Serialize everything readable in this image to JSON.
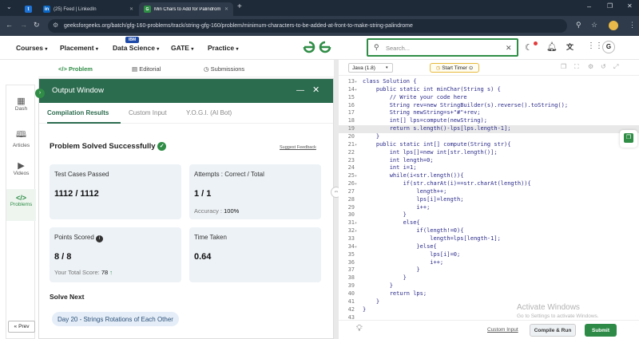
{
  "browser": {
    "tabs": [
      {
        "label": "(25) Feed | LinkedIn"
      },
      {
        "label": "Min Chars to Add for Palindrom"
      }
    ],
    "url": "geeksforgeeks.org/batch/gfg-160-problems/track/string-gfg-160/problem/minimum-characters-to-be-added-at-front-to-make-string-palindrome"
  },
  "site": {
    "nav": [
      "Courses",
      "Placement",
      "Data Science",
      "GATE",
      "Practice"
    ],
    "badge": "IBM",
    "search_placeholder": "Search...",
    "avatar": "G"
  },
  "rail": [
    {
      "label": "Dash"
    },
    {
      "label": "Articles"
    },
    {
      "label": "Videos"
    },
    {
      "label": "Problems"
    }
  ],
  "prev_label": "Prev",
  "problem_tabs": [
    "Problem",
    "Editorial",
    "Submissions"
  ],
  "output": {
    "title": "Output Window",
    "tabs": [
      "Compilation Results",
      "Custom Input",
      "Y.O.G.I. (AI Bot)"
    ],
    "status": "Problem Solved Successfully",
    "suggest": "Suggest Feedback",
    "cards": {
      "tests_label": "Test Cases Passed",
      "tests_value": "1112 / 1112",
      "attempts_label": "Attempts : Correct / Total",
      "attempts_value": "1 / 1",
      "accuracy_label": "Accuracy :",
      "accuracy_value": "100%",
      "points_label": "Points Scored",
      "points_value": "8 / 8",
      "total_label": "Your Total Score:",
      "total_value": "78",
      "time_label": "Time Taken",
      "time_value": "0.64"
    },
    "solve_next": "Solve Next",
    "next_problem": "Day 20 - Strings Rotations of Each Other"
  },
  "editor": {
    "language": "Java (1.8)",
    "timer": "Start Timer",
    "lines": [
      {
        "n": "13",
        "f": "▾",
        "t": "class Solution {"
      },
      {
        "n": "14",
        "f": "▾",
        "t": "    public static int minChar(String s) {"
      },
      {
        "n": "15",
        "f": "",
        "t": "        // Write your code here"
      },
      {
        "n": "16",
        "f": "",
        "t": "        String rev=new StringBuilder(s).reverse().toString();"
      },
      {
        "n": "17",
        "f": "",
        "t": "        String newString=s+\"#\"+rev;"
      },
      {
        "n": "18",
        "f": "",
        "t": "        int[] lps=compute(newString);"
      },
      {
        "n": "19",
        "f": "",
        "t": "        return s.length()-lps[lps.length-1];"
      },
      {
        "n": "20",
        "f": "",
        "t": "    }"
      },
      {
        "n": "21",
        "f": "▾",
        "t": "    public static int[] compute(String str){"
      },
      {
        "n": "22",
        "f": "",
        "t": "        int lps[]=new int[str.length()];"
      },
      {
        "n": "23",
        "f": "",
        "t": "        int length=0;"
      },
      {
        "n": "24",
        "f": "",
        "t": "        int i=1;"
      },
      {
        "n": "25",
        "f": "▾",
        "t": "        while(i<str.length()){"
      },
      {
        "n": "26",
        "f": "▾",
        "t": "            if(str.charAt(i)==str.charAt(length)){"
      },
      {
        "n": "27",
        "f": "",
        "t": "                length++;"
      },
      {
        "n": "28",
        "f": "",
        "t": "                lps[i]=length;"
      },
      {
        "n": "29",
        "f": "",
        "t": "                i++;"
      },
      {
        "n": "30",
        "f": "",
        "t": "            }"
      },
      {
        "n": "31",
        "f": "▾",
        "t": "            else{"
      },
      {
        "n": "32",
        "f": "▾",
        "t": "                if(length!=0){"
      },
      {
        "n": "33",
        "f": "",
        "t": "                    length=lps[length-1];"
      },
      {
        "n": "34",
        "f": "▾",
        "t": "                }else{"
      },
      {
        "n": "35",
        "f": "",
        "t": "                    lps[i]=0;"
      },
      {
        "n": "36",
        "f": "",
        "t": "                    i++;"
      },
      {
        "n": "37",
        "f": "",
        "t": "                }"
      },
      {
        "n": "38",
        "f": "",
        "t": "            }"
      },
      {
        "n": "39",
        "f": "",
        "t": "        }"
      },
      {
        "n": "40",
        "f": "",
        "t": "        return lps;"
      },
      {
        "n": "41",
        "f": "",
        "t": "    }"
      },
      {
        "n": "42",
        "f": "",
        "t": "}"
      },
      {
        "n": "43",
        "f": "",
        "t": ""
      }
    ],
    "highlight_line": "19",
    "custom_input": "Custom Input",
    "compile_run": "Compile & Run",
    "submit": "Submit"
  },
  "watermark": {
    "title": "Activate Windows",
    "subtitle": "Go to Settings to activate Windows."
  },
  "colors": {
    "brand_green": "#2f8d46",
    "header_green": "#2b6b4e",
    "submit_green": "#2e8b47"
  }
}
